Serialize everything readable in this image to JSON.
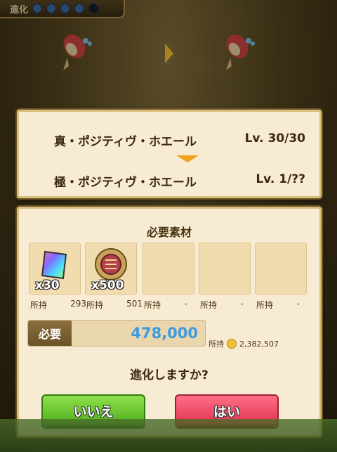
{
  "header": {
    "evolution_label": "進化"
  },
  "evolution": {
    "from_name": "真・ポジティヴ・ホエール",
    "from_level": "Lv. 30/30",
    "to_name": "極・ポジティヴ・ホエール",
    "to_level": "Lv. 1/??"
  },
  "materials": {
    "title": "必要素材",
    "slots": [
      {
        "qty": "x30",
        "own_label": "所持",
        "own_value": "293",
        "icon": "rainbow-card-icon"
      },
      {
        "qty": "x500",
        "own_label": "所持",
        "own_value": "501",
        "icon": "laurel-medal-icon"
      },
      {
        "qty": "",
        "own_label": "所持",
        "own_value": "-",
        "icon": ""
      },
      {
        "qty": "",
        "own_label": "所持",
        "own_value": "-",
        "icon": ""
      },
      {
        "qty": "",
        "own_label": "所持",
        "own_value": "-",
        "icon": ""
      }
    ]
  },
  "cost": {
    "need_label": "必要",
    "need_value": "478,000",
    "own_label": "所持",
    "own_value": "2,382,507"
  },
  "confirm": {
    "question": "進化しますか?",
    "no_label": "いいえ",
    "yes_label": "はい"
  },
  "colors": {
    "accent_blue": "#3f9be0",
    "yes_red": "#e0304f",
    "no_green": "#4fae1d",
    "panel": "#f7ecd3"
  }
}
